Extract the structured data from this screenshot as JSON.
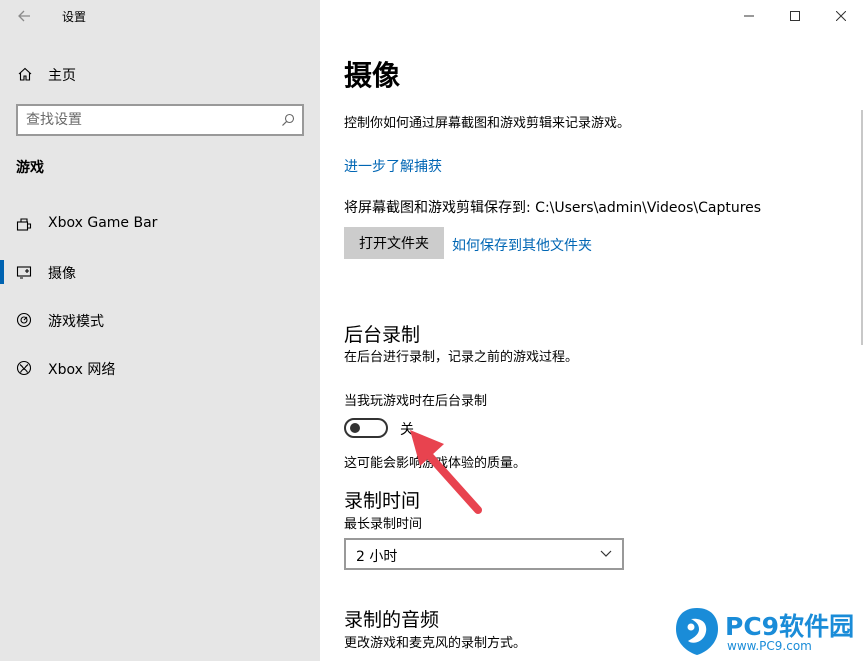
{
  "window": {
    "title": "设置",
    "controls": {
      "minimize": "—",
      "maximize": "□",
      "close": "✕"
    }
  },
  "sidebar": {
    "home_label": "主页",
    "search_placeholder": "查找设置",
    "section_title": "游戏",
    "items": [
      {
        "label": "Xbox Game Bar",
        "icon": "gamebar-icon",
        "active": false
      },
      {
        "label": "摄像",
        "icon": "capture-icon",
        "active": true
      },
      {
        "label": "游戏模式",
        "icon": "gamemode-icon",
        "active": false
      },
      {
        "label": "Xbox 网络",
        "icon": "xbox-icon",
        "active": false
      }
    ]
  },
  "main": {
    "title": "摄像",
    "description": "控制你如何通过屏幕截图和游戏剪辑来记录游戏。",
    "learn_more_link": "进一步了解捕获",
    "save_path": "将屏幕截图和游戏剪辑保存到: C:\\Users\\admin\\Videos\\Captures",
    "open_folder_button": "打开文件夹",
    "save_elsewhere_link": "如何保存到其他文件夹",
    "background_recording": {
      "heading": "后台录制",
      "description": "在后台进行录制，记录之前的游戏过程。",
      "toggle_caption": "当我玩游戏时在后台录制",
      "toggle_state": "关",
      "toggle_on": false,
      "note": "这可能会影响游戏体验的质量。"
    },
    "record_time": {
      "heading": "录制时间",
      "label": "最长录制时间",
      "selected": "2 小时"
    },
    "audio": {
      "heading": "录制的音频",
      "description": "更改游戏和麦克风的录制方式。"
    }
  },
  "watermark": {
    "text": "PC9软件园",
    "sub": "www.PC9.com"
  },
  "colors": {
    "sidebar_bg": "#e6e6e6",
    "accent": "#0063b1",
    "link": "#0066b4",
    "arrow": "#e8434f",
    "watermark": "#1a8cd8"
  }
}
